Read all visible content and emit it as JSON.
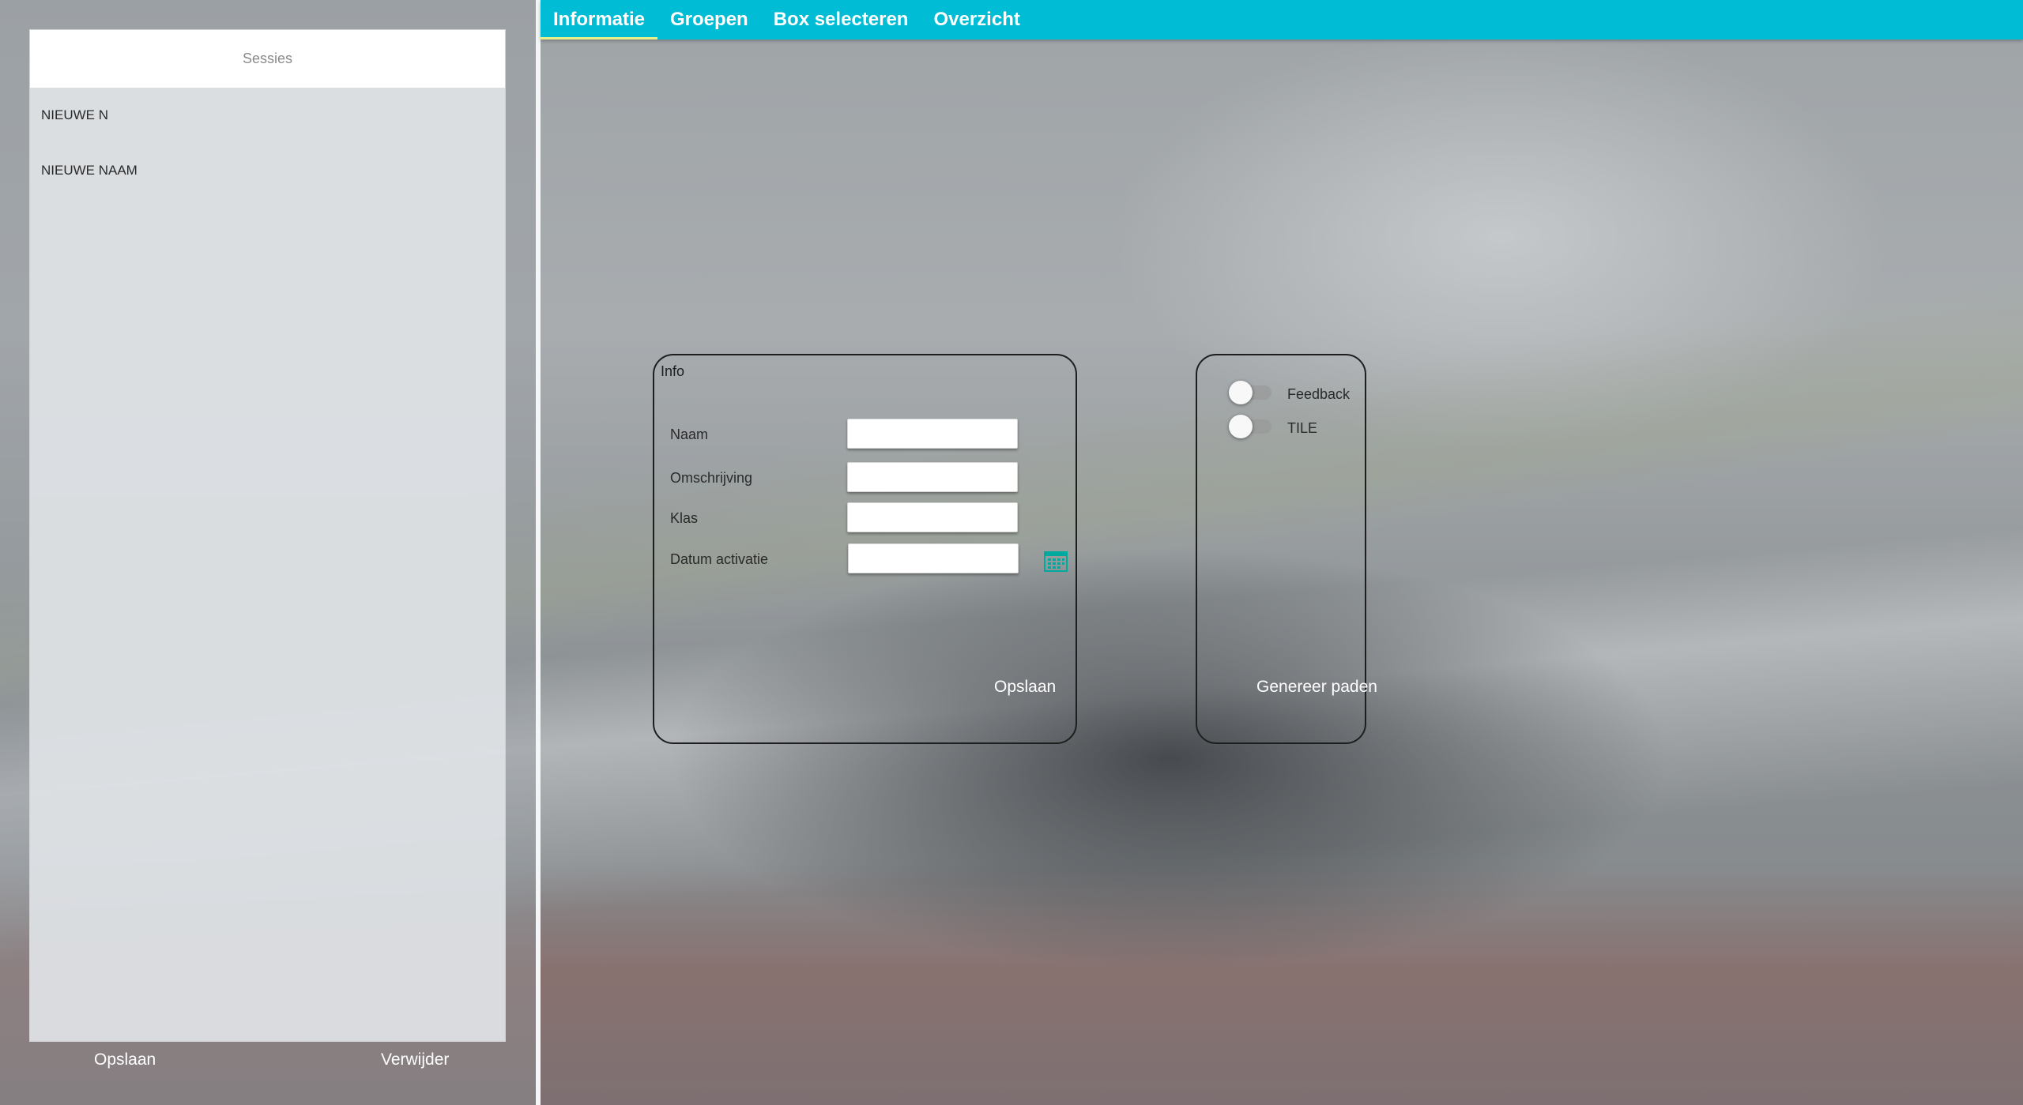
{
  "sidebar": {
    "header": "Sessies",
    "items": [
      {
        "label": "NIEUWE N"
      },
      {
        "label": "NIEUWE NAAM"
      }
    ],
    "save_label": "Opslaan",
    "delete_label": "Verwijder"
  },
  "nav": {
    "tabs": [
      {
        "label": "Informatie",
        "active": true
      },
      {
        "label": "Groepen",
        "active": false
      },
      {
        "label": "Box selecteren",
        "active": false
      },
      {
        "label": "Overzicht",
        "active": false
      }
    ]
  },
  "info": {
    "title": "Info",
    "fields": {
      "naam": {
        "label": "Naam",
        "value": ""
      },
      "omschrijving": {
        "label": "Omschrijving",
        "value": ""
      },
      "klas": {
        "label": "Klas",
        "value": ""
      },
      "datum": {
        "label": "Datum activatie",
        "value": ""
      }
    },
    "save_label": "Opslaan"
  },
  "options": {
    "toggles": [
      {
        "label": "Feedback",
        "on": false
      },
      {
        "label": "TILE",
        "on": false
      }
    ],
    "generate_label": "Genereer paden"
  },
  "colors": {
    "accent": "#00bcd4",
    "active_tab_underline": "#e8f08c",
    "calendar_icon": "#00a99d"
  },
  "icons": {
    "calendar": "calendar-icon"
  }
}
